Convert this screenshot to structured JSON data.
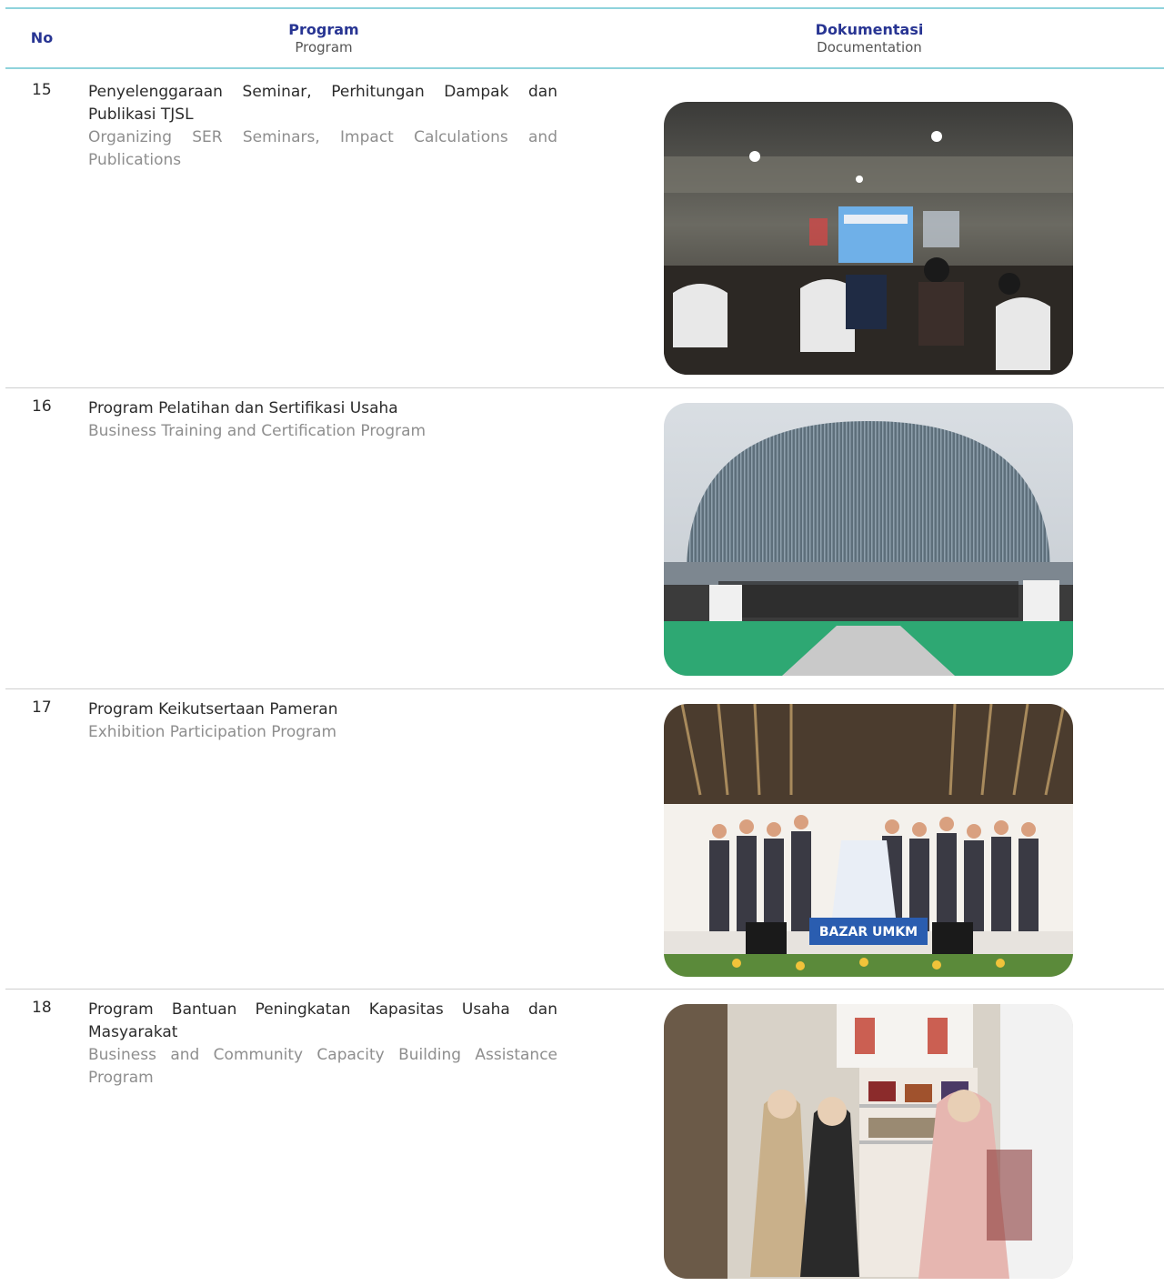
{
  "header": {
    "no": "No",
    "program_id": "Program",
    "program_en": "Program",
    "doc_id": "Dokumentasi",
    "doc_en": "Documentation"
  },
  "rows": [
    {
      "no": "15",
      "title_id": "Penyelenggaraan Seminar, Perhitungan Dampak dan Publikasi TJSL",
      "title_en": "Organizing SER Seminars, Impact Calculations and Publications",
      "photo": "seminar-hall-photo"
    },
    {
      "no": "16",
      "title_id": "Program Pelatihan dan Sertifikasi Usaha",
      "title_en": "Business Training and Certification Program",
      "photo": "dome-building-group-photo"
    },
    {
      "no": "17",
      "title_id": "Program Keikutsertaan Pameran",
      "title_en": "Exhibition Participation Program",
      "photo": "exhibition-stage-group-photo",
      "photo_sign": "BAZAR UMKM"
    },
    {
      "no": "18",
      "title_id": "Program Bantuan Peningkatan Kapasitas Usaha dan Masyarakat",
      "title_en": "Business and Community Capacity Building Assistance Program",
      "photo": "shop-women-photo"
    }
  ],
  "colors": {
    "header_line": "#8fd3dc",
    "header_text": "#283593",
    "row_divider": "#cfcfcf",
    "english_text": "#8e8e8e"
  }
}
